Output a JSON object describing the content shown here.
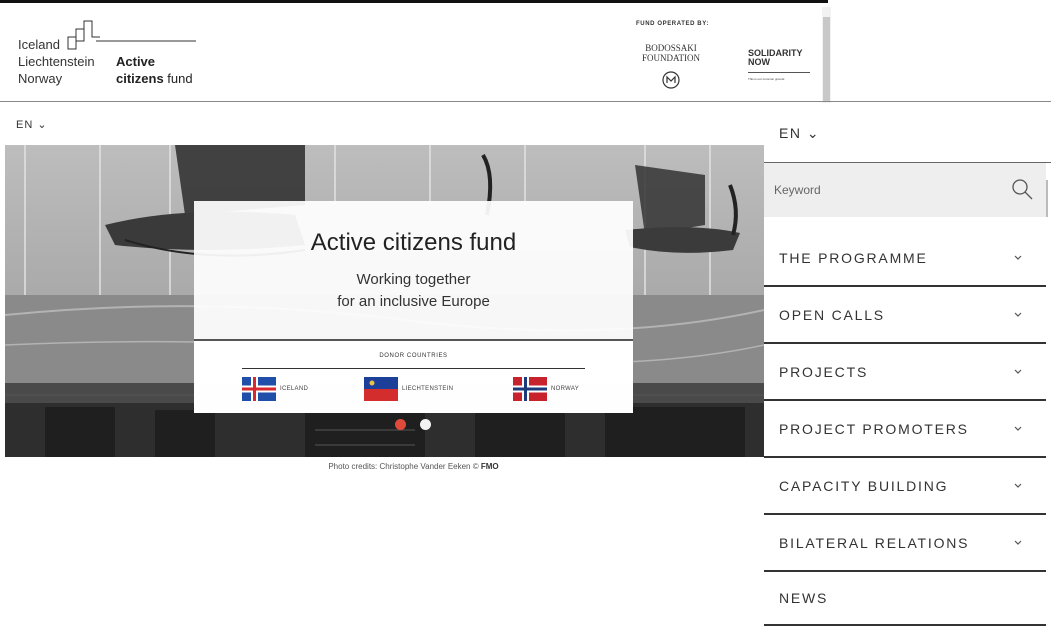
{
  "header": {
    "logo": {
      "line1": "Iceland",
      "line2": "Liechtenstein",
      "line3": "Norway",
      "active_line1": "Active",
      "active_line2_bold": "citizens",
      "active_line2_rest": " fund"
    },
    "fund_operated_by": "FUND OPERATED BY:",
    "bodossaki": "BODOSSAKI FOUNDATION",
    "solidarity": {
      "name": "SOLIDARITY NOW",
      "tagline": "This is our common ground"
    }
  },
  "language": {
    "left": "EN ⌄",
    "right": "EN ⌄"
  },
  "hero": {
    "title": "Active citizens fund",
    "subtitle_line1": "Working together",
    "subtitle_line2": "for an inclusive Europe",
    "donor_label": "DONOR COUNTRIES",
    "countries": [
      {
        "name": "ICELAND",
        "flag": "iceland-flag"
      },
      {
        "name": "LIECHTENSTEIN",
        "flag": "liechtenstein-flag"
      },
      {
        "name": "NORWAY",
        "flag": "norway-flag"
      }
    ],
    "slides": 2,
    "active_slide": 1,
    "credits_prefix": "Photo credits: Christophe Vander Eeken ©",
    "credits_org": "FMO"
  },
  "search": {
    "placeholder": "Keyword",
    "icon": "search-icon"
  },
  "menu": {
    "items": [
      {
        "label": "THE PROGRAMME",
        "has_dropdown": true
      },
      {
        "label": "OPEN CALLS",
        "has_dropdown": true
      },
      {
        "label": "PROJECTS",
        "has_dropdown": true
      },
      {
        "label": "PROJECT PROMOTERS",
        "has_dropdown": true
      },
      {
        "label": "CAPACITY BUILDING",
        "has_dropdown": true
      },
      {
        "label": "BILATERAL RELATIONS",
        "has_dropdown": true
      },
      {
        "label": "NEWS",
        "has_dropdown": false
      }
    ]
  },
  "colors": {
    "accent_dot": "#e04a3a",
    "iceland_blue": "#1f4fa8",
    "iceland_red": "#d7282f",
    "liechtenstein_blue": "#1c3f9a",
    "liechtenstein_red": "#d32d2d",
    "norway_red": "#c8222c",
    "norway_blue": "#1d3b7a"
  }
}
